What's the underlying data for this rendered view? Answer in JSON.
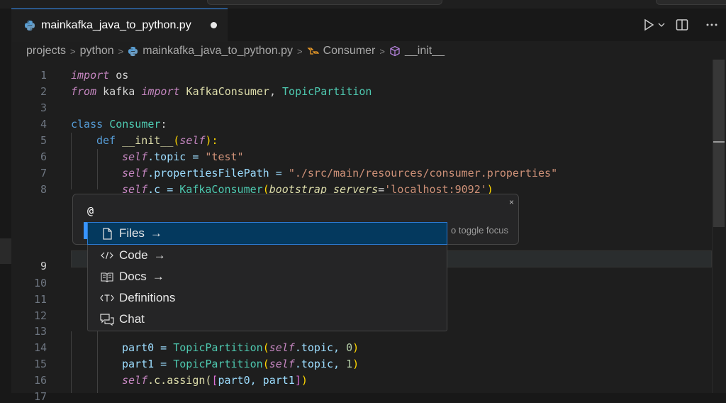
{
  "tab": {
    "title": "mainkafka_java_to_python.py",
    "icon": "python-file-icon"
  },
  "breadcrumb": [
    "projects",
    "python",
    "mainkafka_java_to_python.py",
    "Consumer",
    "__init__"
  ],
  "lines": {
    "1": {
      "num": "1",
      "a": "import",
      "b": " os"
    },
    "2": {
      "num": "2",
      "a": "from",
      "b": " kafka ",
      "c": "import",
      "d": " KafkaConsumer",
      "e": ", ",
      "f": "TopicPartition"
    },
    "3": {
      "num": "3"
    },
    "4": {
      "num": "4",
      "a": "class",
      "b": " ",
      "c": "Consumer",
      "d": ":"
    },
    "5": {
      "num": "5",
      "a": "def",
      "b": " ",
      "c": "__init__",
      "d": "(",
      "e": "self",
      "f": "):"
    },
    "6": {
      "num": "6",
      "a": "self",
      "b": ".topic = ",
      "c": "\"test\""
    },
    "7": {
      "num": "7",
      "a": "self",
      "b": ".propertiesFilePath = ",
      "c": "\"./src/main/resources/consumer.properties\""
    },
    "8": {
      "num": "8",
      "a": "self",
      "b": ".c = ",
      "c": "KafkaConsumer",
      "d": "(",
      "e": "bootstrap_servers",
      "f": "=",
      "g": "'localhost:9092'",
      "h": ")"
    },
    "9": {
      "num": "9"
    },
    "10": {
      "num": "10"
    },
    "11": {
      "num": "11"
    },
    "12": {
      "num": "12"
    },
    "13": {
      "num": "13"
    },
    "14": {
      "num": "14",
      "a": "part0 = ",
      "b": "TopicPartition",
      "c": "(",
      "d": "self",
      "e": ".topic, ",
      "f": "0",
      "g": ")"
    },
    "15": {
      "num": "15",
      "a": "part1 = ",
      "b": "TopicPartition",
      "c": "(",
      "d": "self",
      "e": ".topic, ",
      "f": "1",
      "g": ")"
    },
    "16": {
      "num": "16",
      "a": "self",
      "b": ".c.assign(",
      "c": "[",
      "d": "part0, part1",
      "e": "]",
      "f": ")"
    },
    "17": {
      "num": "17"
    }
  },
  "chat_input": {
    "value": "@",
    "hint": "o toggle focus",
    "close": "×"
  },
  "menu": {
    "items": [
      {
        "label": "Files",
        "icon": "file-icon",
        "arrow": "→"
      },
      {
        "label": "Code",
        "icon": "code-icon",
        "arrow": "→"
      },
      {
        "label": "Docs",
        "icon": "book-icon",
        "arrow": "→"
      },
      {
        "label": "Definitions",
        "icon": "symbol-icon"
      },
      {
        "label": "Chat",
        "icon": "chat-icon"
      }
    ]
  },
  "colors": {
    "accent": "#3794ff",
    "selected": "#04395e",
    "keyword": "#c586c0",
    "string": "#ce9178",
    "class": "#4ec9b0",
    "function": "#dcdcaa"
  }
}
